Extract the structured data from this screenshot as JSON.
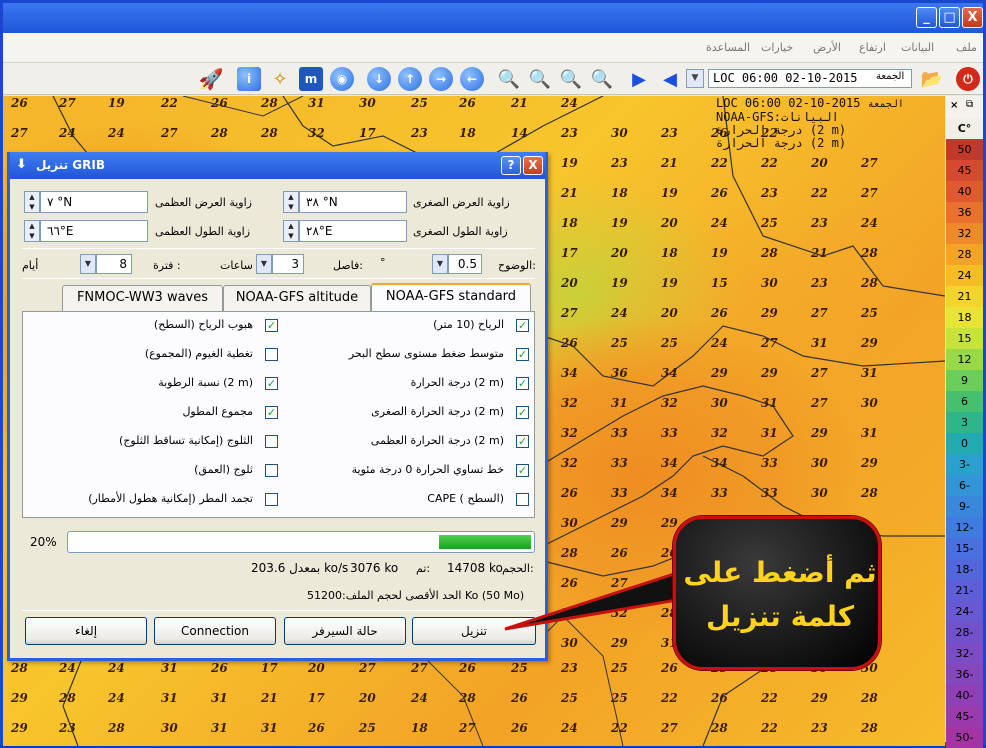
{
  "window": {
    "controls": {
      "minimize": "_",
      "maximize": "□",
      "close": "X"
    }
  },
  "menu": [
    "ملف",
    "البيانات",
    "ارتفاع",
    "الأرض",
    "خيارات",
    "المساعدة"
  ],
  "toolbar": {
    "time_value": "LOC 06:00 02-10-2015",
    "time_day": "الجمعة"
  },
  "map_legend": {
    "line1": "LOC 06:00 02-10-2015",
    "line1_day": "الجمعة",
    "line2": "NOAA-GFS:البيانات",
    "line3": "درجة الحرارة (2 m)",
    "line4": "درجة الحرارة (2 m)"
  },
  "colorbar": {
    "unit": "C°",
    "close": "×",
    "entries": [
      {
        "v": "50",
        "c": "#c0392b"
      },
      {
        "v": "45",
        "c": "#d44a30"
      },
      {
        "v": "40",
        "c": "#e05a31"
      },
      {
        "v": "36",
        "c": "#e9702f"
      },
      {
        "v": "32",
        "c": "#ef8a2c"
      },
      {
        "v": "28",
        "c": "#f3a328"
      },
      {
        "v": "24",
        "c": "#f6bc26"
      },
      {
        "v": "21",
        "c": "#f4d32c"
      },
      {
        "v": "18",
        "c": "#e8e336"
      },
      {
        "v": "15",
        "c": "#c7e23a"
      },
      {
        "v": "12",
        "c": "#98d94a"
      },
      {
        "v": "9",
        "c": "#6bcd5b"
      },
      {
        "v": "6",
        "c": "#47c06e"
      },
      {
        "v": "3",
        "c": "#2eb58a"
      },
      {
        "v": "0",
        "c": "#21aab0"
      },
      {
        "v": "3-",
        "c": "#2aa0cc"
      },
      {
        "v": "6-",
        "c": "#3394d6"
      },
      {
        "v": "9-",
        "c": "#3a87dc"
      },
      {
        "v": "12-",
        "c": "#407be0"
      },
      {
        "v": "15-",
        "c": "#4a6fdf"
      },
      {
        "v": "18-",
        "c": "#5466dc"
      },
      {
        "v": "21-",
        "c": "#5e5fd8"
      },
      {
        "v": "24-",
        "c": "#6858d2"
      },
      {
        "v": "28-",
        "c": "#7252cb"
      },
      {
        "v": "32-",
        "c": "#7c4cc4"
      },
      {
        "v": "36-",
        "c": "#8646bc"
      },
      {
        "v": "40-",
        "c": "#9040b4"
      },
      {
        "v": "45-",
        "c": "#9a3aac"
      },
      {
        "v": "50-",
        "c": "#a434a4"
      }
    ]
  },
  "map_values": [
    [
      "26",
      "27",
      "19",
      "22",
      "26",
      "28",
      "31",
      "30",
      "25",
      "26",
      "21",
      "24",
      "",
      "",
      "",
      ""
    ],
    [
      "27",
      "24",
      "24",
      "27",
      "28",
      "28",
      "32",
      "17",
      "23",
      "18",
      "14",
      "23",
      "30",
      "23",
      "26",
      "22"
    ],
    [
      "",
      "",
      "",
      "",
      "",
      "",
      "",
      "",
      "",
      "",
      "18",
      "19",
      "23",
      "21",
      "22",
      "22",
      "20",
      "27"
    ],
    [
      "",
      "",
      "",
      "",
      "",
      "",
      "",
      "",
      "",
      "",
      "14",
      "21",
      "18",
      "19",
      "26",
      "23",
      "22",
      "27"
    ],
    [
      "",
      "",
      "",
      "",
      "",
      "",
      "",
      "",
      "",
      "",
      "13",
      "18",
      "19",
      "20",
      "24",
      "25",
      "23",
      "24"
    ],
    [
      "",
      "",
      "",
      "",
      "",
      "",
      "",
      "",
      "",
      "",
      "16",
      "17",
      "20",
      "18",
      "19",
      "28",
      "21",
      "28"
    ],
    [
      "",
      "",
      "",
      "",
      "",
      "",
      "",
      "",
      "",
      "",
      "27",
      "20",
      "19",
      "19",
      "15",
      "30",
      "23",
      "28"
    ],
    [
      "",
      "",
      "",
      "",
      "",
      "",
      "",
      "",
      "",
      "",
      "32",
      "27",
      "24",
      "20",
      "26",
      "29",
      "27",
      "25"
    ],
    [
      "",
      "",
      "",
      "",
      "",
      "",
      "",
      "",
      "",
      "",
      "33",
      "26",
      "25",
      "25",
      "24",
      "27",
      "31",
      "29"
    ],
    [
      "",
      "",
      "",
      "",
      "",
      "",
      "",
      "",
      "",
      "",
      "32",
      "34",
      "36",
      "34",
      "29",
      "29",
      "27",
      "31"
    ],
    [
      "",
      "",
      "",
      "",
      "",
      "",
      "",
      "",
      "",
      "",
      "31",
      "32",
      "31",
      "32",
      "30",
      "31",
      "27",
      "30"
    ],
    [
      "",
      "",
      "",
      "",
      "",
      "",
      "",
      "",
      "",
      "",
      "31",
      "32",
      "33",
      "33",
      "32",
      "31",
      "29",
      "31"
    ],
    [
      "",
      "",
      "",
      "",
      "",
      "",
      "",
      "",
      "",
      "",
      "28",
      "32",
      "33",
      "34",
      "34",
      "33",
      "30",
      "29"
    ],
    [
      "",
      "",
      "",
      "",
      "",
      "",
      "",
      "",
      "",
      "",
      "27",
      "26",
      "33",
      "34",
      "33",
      "33",
      "30",
      "28"
    ],
    [
      "",
      "",
      "",
      "",
      "",
      "",
      "",
      "",
      "",
      "",
      "29",
      "30",
      "29",
      "29",
      "32",
      "",
      "",
      ""
    ],
    [
      "",
      "",
      "",
      "",
      "",
      "",
      "",
      "",
      "",
      "",
      "24",
      "28",
      "26",
      "26",
      "33",
      "",
      "",
      ""
    ],
    [
      "",
      "",
      "",
      "",
      "",
      "",
      "",
      "",
      "",
      "",
      "25",
      "26",
      "27",
      "27",
      "27",
      "",
      "",
      ""
    ],
    [
      "",
      "",
      "",
      "",
      "",
      "",
      "",
      "",
      "",
      "",
      "27",
      "29",
      "32",
      "28",
      "30",
      "",
      "",
      ""
    ],
    [
      "",
      "",
      "",
      "",
      "",
      "",
      "",
      "",
      "",
      "",
      "32",
      "30",
      "29",
      "31",
      "",
      "29",
      "29",
      "28"
    ],
    [
      "28",
      "24",
      "24",
      "31",
      "26",
      "17",
      "20",
      "27",
      "27",
      "26",
      "25",
      "23",
      "25",
      "26",
      "25",
      "28",
      "30",
      "30"
    ],
    [
      "29",
      "28",
      "24",
      "31",
      "31",
      "21",
      "17",
      "20",
      "24",
      "28",
      "26",
      "25",
      "25",
      "22",
      "26",
      "22",
      "29",
      "28"
    ],
    [
      "29",
      "23",
      "28",
      "30",
      "31",
      "31",
      "26",
      "25",
      "18",
      "27",
      "26",
      "24",
      "22",
      "27",
      "28",
      "22",
      "23",
      "28"
    ]
  ],
  "dialog": {
    "title": "تنزيل GRIB",
    "help_btn": "?",
    "close_btn": "X",
    "lat_min_label": "زاوية العرض الصغرى",
    "lat_min_value": "٣٨ °N",
    "lat_max_label": "زاوية العرض العظمى",
    "lat_max_value": "٧ °N",
    "lon_min_label": "زاوية الطول الصغرى",
    "lon_min_value": "٢٨°E",
    "lon_max_label": "زاوية الطول العظمى",
    "lon_max_value": "٦٦°E",
    "resolution_label": "الوضوح:",
    "resolution_value": "0.5",
    "resolution_unit": "°",
    "interval_label": "فاصل:",
    "interval_value": "3",
    "interval_unit": "ساعات",
    "period_label": "فترة :",
    "period_value": "8",
    "period_unit": "أيام",
    "tabs": [
      "NOAA-GFS standard",
      "NOAA-GFS altitude",
      "FNMOC-WW3 waves"
    ],
    "options_right": [
      {
        "label": "الرياح (10 متر)",
        "checked": true
      },
      {
        "label": "متوسط ضغط مستوى سطح البحر",
        "checked": true
      },
      {
        "label": "درجة الحرارة (2 m)",
        "checked": true
      },
      {
        "label": "درجة الحرارة الصغرى (2 m)",
        "checked": true
      },
      {
        "label": "درجة الحرارة العظمى (2 m)",
        "checked": true
      },
      {
        "label": "خط تساوي الحرارة 0 درجة مئوية",
        "checked": true
      },
      {
        "label": "CAPE ( السطح)",
        "checked": false
      }
    ],
    "options_left": [
      {
        "label": "هبوب الرياح (السطح)",
        "checked": true
      },
      {
        "label": "تغطية الغيوم (المجموع)",
        "checked": false
      },
      {
        "label": "نسبة الرطوبة (2 m)",
        "checked": true
      },
      {
        "label": "مجموع المطول",
        "checked": true
      },
      {
        "label": "الثلوج (إمكانية تساقط الثلوج)",
        "checked": false
      },
      {
        "label": "ثلوج (العمق)",
        "checked": false
      },
      {
        "label": "تجمد المطر (إمكانية هطول الأمطار)",
        "checked": false
      }
    ],
    "progress_percent": "20%",
    "progress_fraction": 0.2,
    "size_label": "الحجم:",
    "size_value": "14708 ko",
    "to_label": "تم:",
    "done_value": "3076 ko",
    "rate_value": "بمعدل 203.6 ko/s",
    "max_size_text": "الحد الأقصى لحجم الملف:51200 Ko (50 Mo)",
    "buttons": {
      "download": "تنزيل",
      "server_status": "حالة السيرفر",
      "connection": "Connection",
      "cancel": "إلغاء"
    }
  },
  "callout": {
    "line1": "ثم أضغط على",
    "line2": "كلمة تنزيل"
  }
}
